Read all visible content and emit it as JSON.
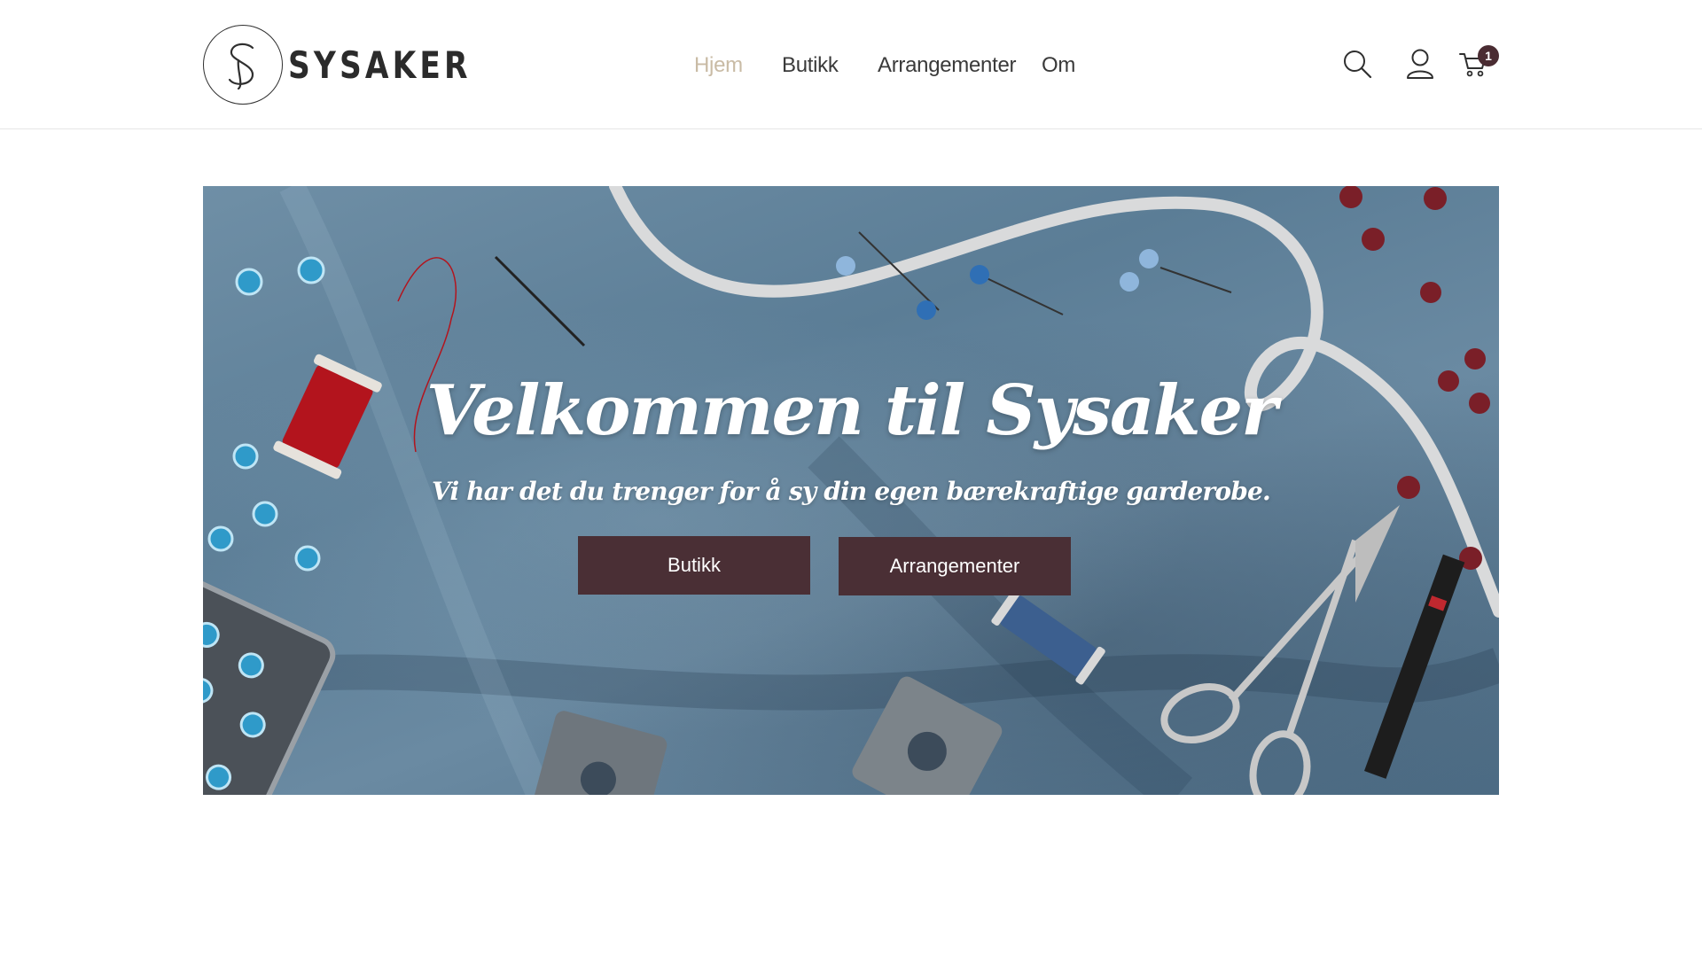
{
  "brand": {
    "name": "SYSAKER",
    "logo_letter": "S"
  },
  "nav": {
    "items": [
      {
        "label": "Hjem",
        "active": true
      },
      {
        "label": "Butikk",
        "active": false
      },
      {
        "label": "Arrangementer",
        "active": false
      },
      {
        "label": "Om",
        "active": false
      }
    ]
  },
  "header_icons": {
    "search": "search-icon",
    "account": "user-icon",
    "cart": "cart-icon",
    "cart_count": "1"
  },
  "hero": {
    "title": "Velkommen til Sysaker",
    "subtitle": "Vi har det du trenger for å sy din egen bærekraftige garderobe.",
    "buttons": [
      {
        "label": "Butikk"
      },
      {
        "label": "Arrangementer"
      }
    ]
  },
  "colors": {
    "accent": "#4a2f35",
    "nav_active": "#c9bba5",
    "fabric": "#5b7d96"
  }
}
